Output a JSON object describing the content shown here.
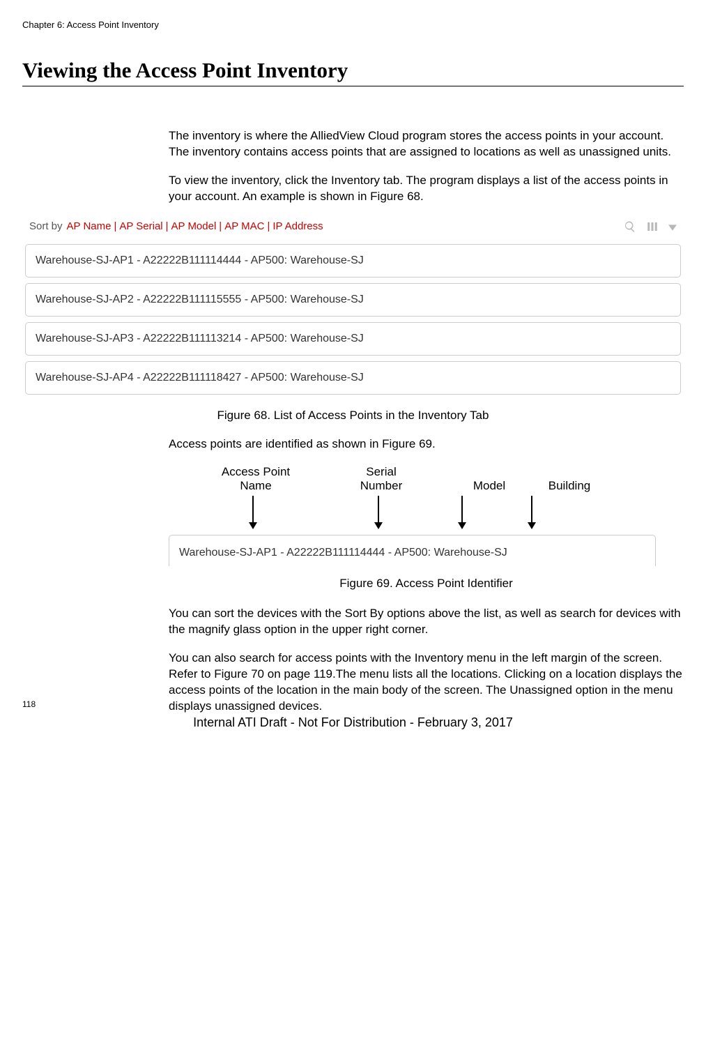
{
  "chapter_header": "Chapter 6: Access Point Inventory",
  "section_title": "Viewing the Access Point Inventory",
  "paragraphs": {
    "p1": "The inventory is where the AlliedView Cloud program stores the access points in your account. The inventory contains access points that are assigned to locations as well as unassigned units.",
    "p2": "To view the inventory, click the Inventory tab. The program displays a list of the access points in your account. An example is shown in Figure 68.",
    "p3": "Access points are identified as shown in Figure 69.",
    "p4": "You can sort the devices with the Sort By options above the list, as well as search for devices with the magnify glass option in the upper right corner.",
    "p5": "You can also search for access points with the Inventory menu in the left margin of the screen. Refer to Figure 70 on page 119.The menu lists all the locations. Clicking on a location displays the access points of the location in the main body of the screen. The Unassigned option in the menu displays unassigned devices."
  },
  "sortbar": {
    "label": "Sort by",
    "options": [
      "AP Name",
      "AP Serial",
      "AP Model",
      "AP MAC",
      "IP Address"
    ],
    "sep": "|",
    "icons": {
      "search": "search-icon",
      "columns": "columns-icon",
      "dropdown": "dropdown-icon"
    }
  },
  "ap_rows": [
    "Warehouse-SJ-AP1 - A22222B111114444 - AP500: Warehouse-SJ",
    "Warehouse-SJ-AP2 - A22222B111115555 - AP500: Warehouse-SJ",
    "Warehouse-SJ-AP3 - A22222B111113214 - AP500: Warehouse-SJ",
    "Warehouse-SJ-AP4 - A22222B111118427 - AP500: Warehouse-SJ"
  ],
  "fig68_caption": "Figure 68. List of Access Points in the Inventory Tab",
  "annot": {
    "col1a": "Access Point",
    "col1b": "Name",
    "col2a": "Serial",
    "col2b": "Number",
    "col3": "Model",
    "col4": "Building"
  },
  "identifier_row": "Warehouse-SJ-AP1 - A22222B111114444 - AP500: Warehouse-SJ",
  "fig69_caption": "Figure 69. Access Point Identifier",
  "page_number": "118",
  "footer": "Internal ATI Draft - Not For Distribution - February 3, 2017"
}
